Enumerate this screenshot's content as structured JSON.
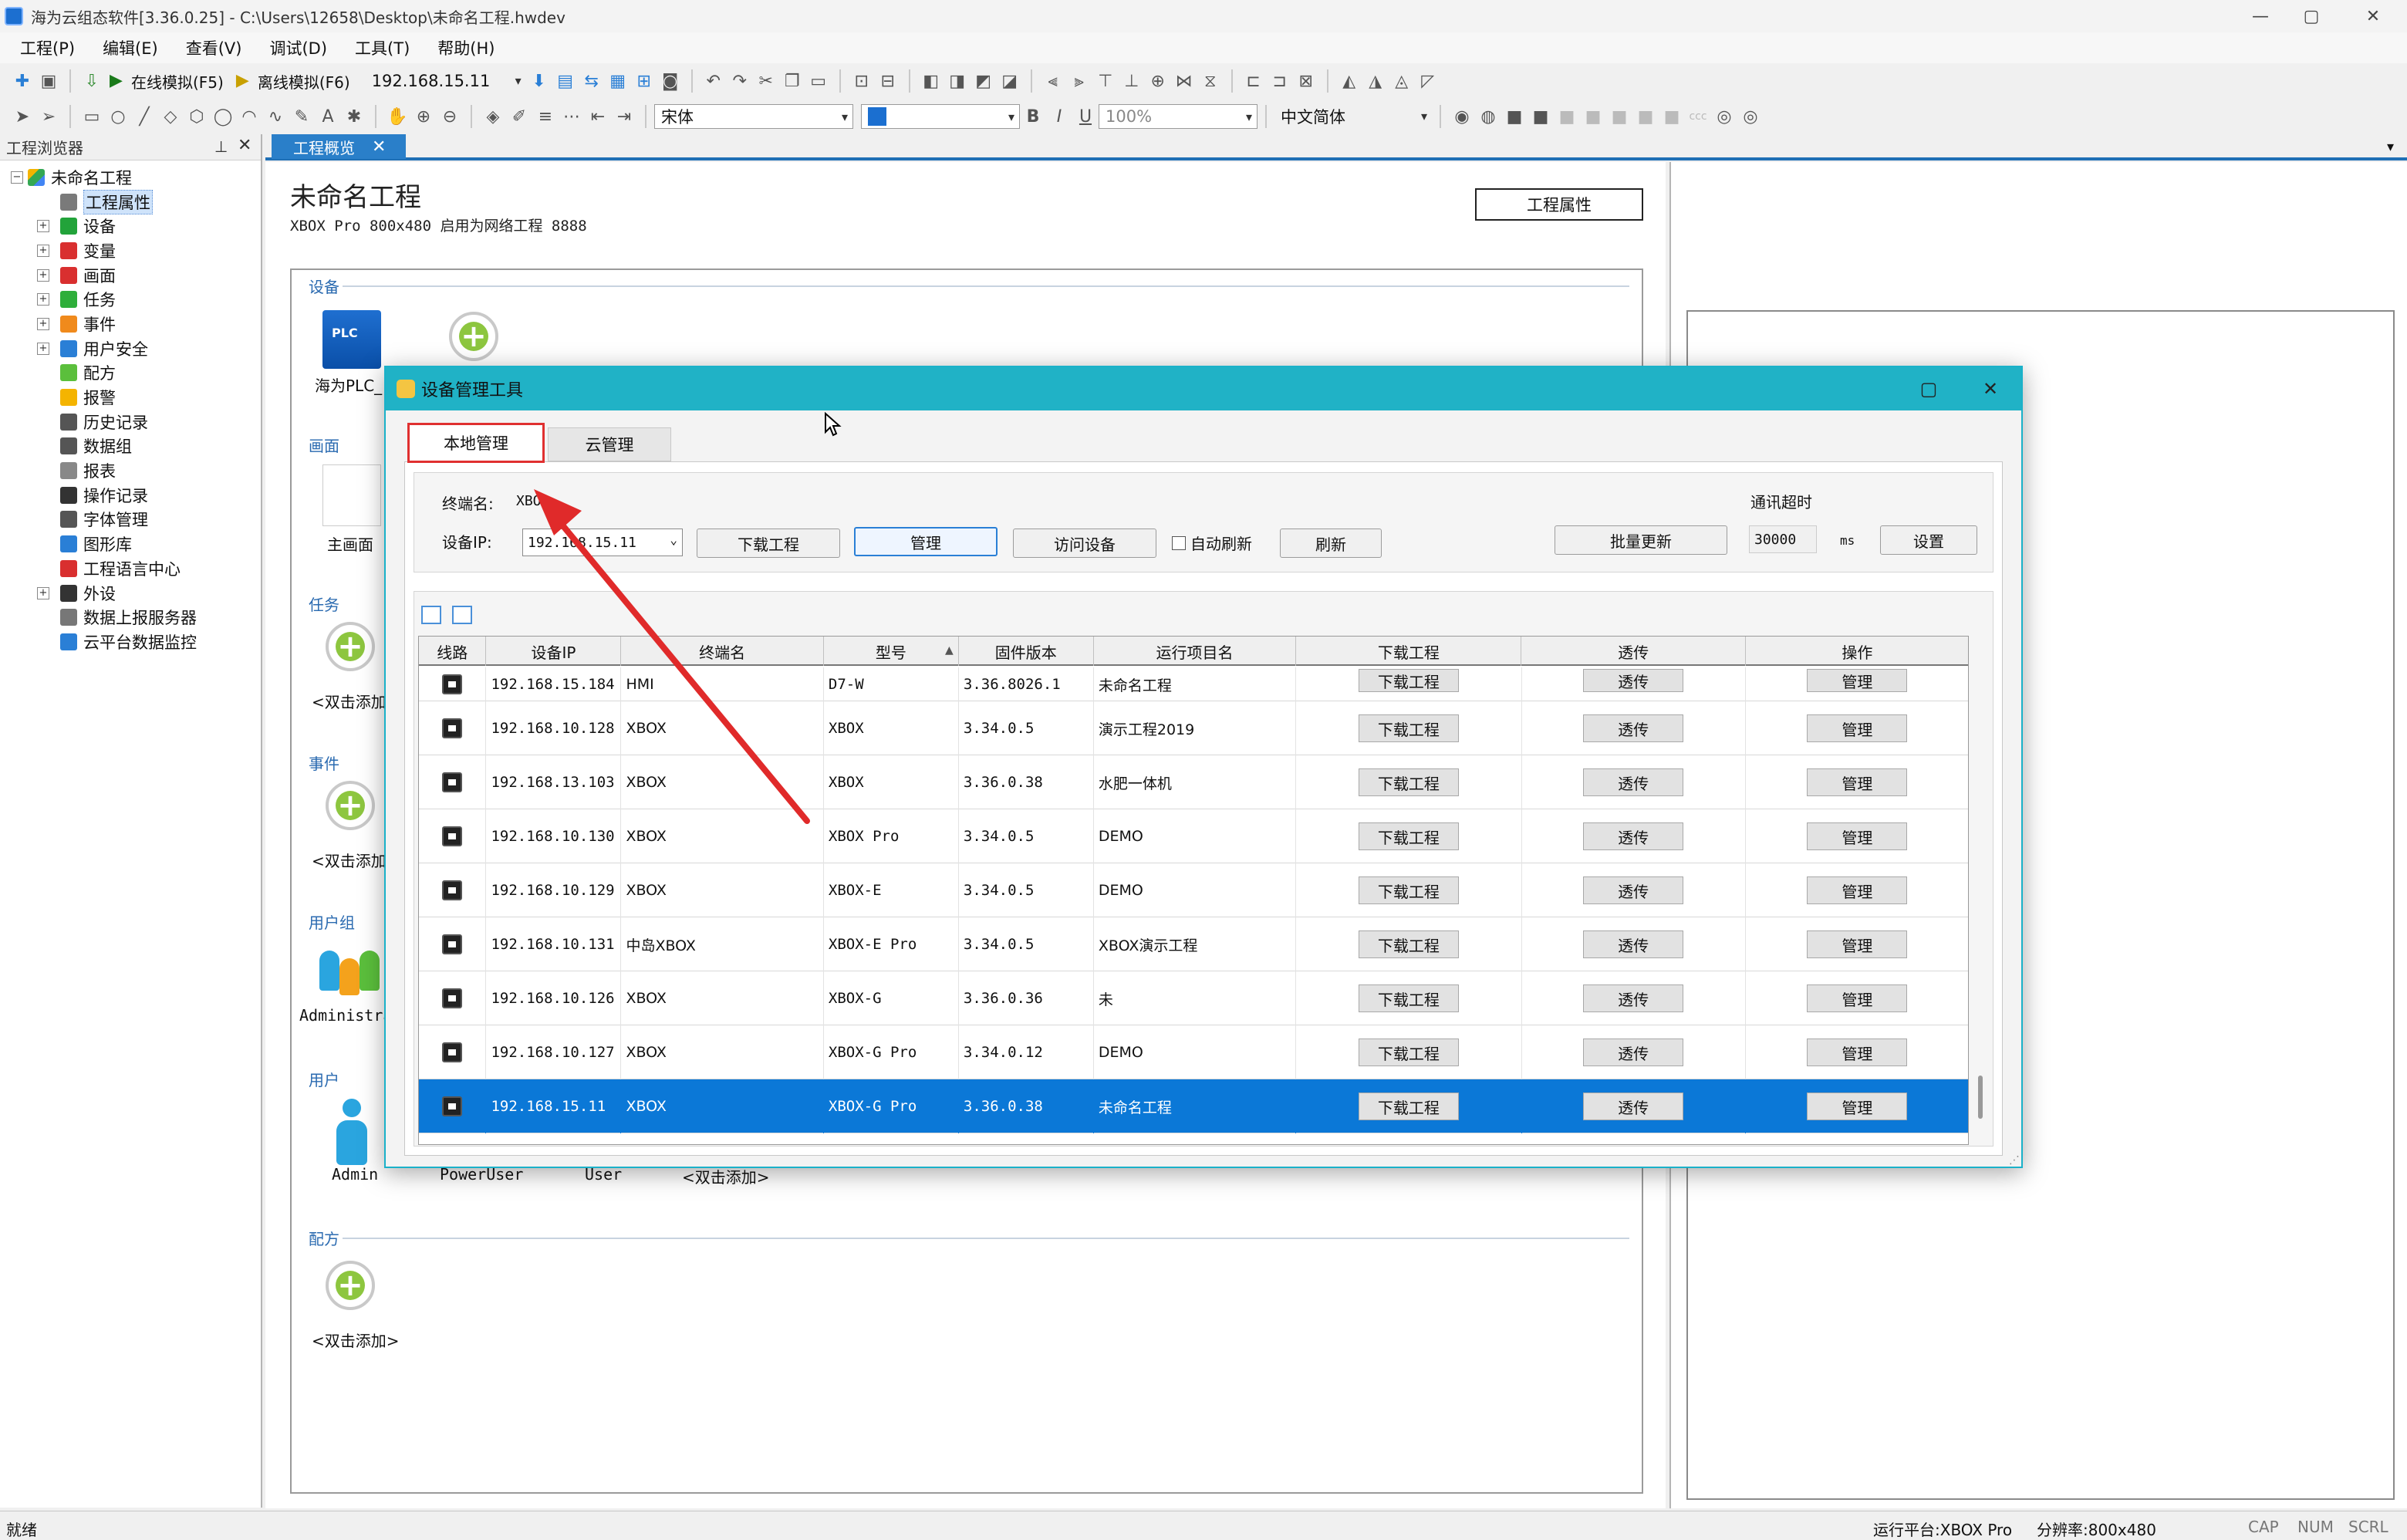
{
  "window": {
    "title": "海为云组态软件[3.36.0.25] - C:\\Users\\12658\\Desktop\\未命名工程.hwdev",
    "minimize": "—",
    "maximize": "▢",
    "close": "✕"
  },
  "menu": [
    "工程(P)",
    "编辑(E)",
    "查看(V)",
    "调试(D)",
    "工具(T)",
    "帮助(H)"
  ],
  "toolbar1": {
    "online_sim": "在线模拟(F5)",
    "offline_sim": "离线模拟(F6)",
    "ip_value": "192.168.15.11"
  },
  "toolbar2": {
    "font_value": "宋体",
    "zoom_value": "100%",
    "language_value": "中文简体"
  },
  "left_panel": {
    "title": "工程浏览器",
    "root": "未命名工程",
    "items": [
      {
        "label": "工程属性",
        "icon": "properties-icon",
        "expandable": false
      },
      {
        "label": "设备",
        "icon": "device-icon",
        "expandable": true
      },
      {
        "label": "变量",
        "icon": "variable-icon",
        "expandable": true
      },
      {
        "label": "画面",
        "icon": "screen-icon",
        "expandable": true
      },
      {
        "label": "任务",
        "icon": "task-icon",
        "expandable": true
      },
      {
        "label": "事件",
        "icon": "event-icon",
        "expandable": true
      },
      {
        "label": "用户安全",
        "icon": "user-security-icon",
        "expandable": true
      },
      {
        "label": "配方",
        "icon": "recipe-icon",
        "expandable": false
      },
      {
        "label": "报警",
        "icon": "alarm-bell-icon",
        "expandable": false
      },
      {
        "label": "历史记录",
        "icon": "history-clock-icon",
        "expandable": false
      },
      {
        "label": "数据组",
        "icon": "data-group-icon",
        "expandable": false
      },
      {
        "label": "报表",
        "icon": "report-icon",
        "expandable": false
      },
      {
        "label": "操作记录",
        "icon": "operation-log-icon",
        "expandable": false
      },
      {
        "label": "字体管理",
        "icon": "font-manager-icon",
        "expandable": false
      },
      {
        "label": "图形库",
        "icon": "graphics-library-icon",
        "expandable": false
      },
      {
        "label": "工程语言中心",
        "icon": "language-flag-icon",
        "expandable": false
      },
      {
        "label": "外设",
        "icon": "peripheral-tools-icon",
        "expandable": true
      },
      {
        "label": "数据上报服务器",
        "icon": "report-server-icon",
        "expandable": false
      },
      {
        "label": "云平台数据监控",
        "icon": "cloud-monitor-icon",
        "expandable": false
      }
    ]
  },
  "tab": {
    "label": "工程概览",
    "close": "✕"
  },
  "overview": {
    "title": "未命名工程",
    "subtitle": "XBOX Pro  800x480  启用为网络工程 8888",
    "properties_button": "工程属性",
    "sections": {
      "device": "设备",
      "screen": "画面",
      "task": "任务",
      "event": "事件",
      "user_group": "用户组",
      "user": "用户",
      "recipe": "配方"
    },
    "device_item": "海为PLC_",
    "plc_badge": "PLC",
    "screen_item": "主画面",
    "add_label": "<双击添加>",
    "group_item": "Administra",
    "users": [
      "Admin",
      "PowerUser",
      "User",
      "<双击添加>"
    ]
  },
  "dialog": {
    "title": "设备管理工具",
    "tabs": {
      "local": "本地管理",
      "cloud": "云管理"
    },
    "terminal_label": "终端名:",
    "terminal_value": "XBO",
    "ip_label": "设备IP:",
    "ip_value": "192.168.15.11",
    "buttons": {
      "download": "下载工程",
      "manage": "管理",
      "visit": "访问设备",
      "auto_refresh": "自动刷新",
      "refresh": "刷新",
      "batch_update": "批量更新",
      "settings": "设置"
    },
    "timeout_label": "通讯超时",
    "timeout_value": "30000",
    "timeout_unit": "ms",
    "grid": {
      "columns": [
        "线路",
        "设备IP",
        "终端名",
        "型号",
        "固件版本",
        "运行项目名",
        "下载工程",
        "透传",
        "操作"
      ],
      "row_btn_download": "下载工程",
      "row_btn_passthrough": "透传",
      "row_btn_manage": "管理",
      "rows": [
        {
          "ip": "192.168.15.184",
          "terminal": "HMI",
          "model": "D7-W",
          "firmware": "3.36.8026.1",
          "project": "未命名工程"
        },
        {
          "ip": "192.168.10.128",
          "terminal": "XBOX",
          "model": "XBOX",
          "firmware": "3.34.0.5",
          "project": "演示工程2019"
        },
        {
          "ip": "192.168.13.103",
          "terminal": "XBOX",
          "model": "XBOX",
          "firmware": "3.36.0.38",
          "project": "水肥一体机"
        },
        {
          "ip": "192.168.10.130",
          "terminal": "XBOX",
          "model": "XBOX Pro",
          "firmware": "3.34.0.5",
          "project": "DEMO"
        },
        {
          "ip": "192.168.10.129",
          "terminal": "XBOX",
          "model": "XBOX-E",
          "firmware": "3.34.0.5",
          "project": "DEMO"
        },
        {
          "ip": "192.168.10.131",
          "terminal": "中岛XBOX",
          "model": "XBOX-E Pro",
          "firmware": "3.34.0.5",
          "project": "XBOX演示工程"
        },
        {
          "ip": "192.168.10.126",
          "terminal": "XBOX",
          "model": "XBOX-G",
          "firmware": "3.36.0.36",
          "project": "未"
        },
        {
          "ip": "192.168.10.127",
          "terminal": "XBOX",
          "model": "XBOX-G Pro",
          "firmware": "3.34.0.12",
          "project": "DEMO"
        },
        {
          "ip": "192.168.15.11",
          "terminal": "XBOX",
          "model": "XBOX-G Pro",
          "firmware": "3.36.0.38",
          "project": "未命名工程",
          "selected": true
        }
      ]
    }
  },
  "status": {
    "left": "就绪",
    "platform": "运行平台:XBOX Pro",
    "resolution": "分辨率:800x480",
    "cap": "CAP",
    "num": "NUM",
    "scrl": "SCRL"
  },
  "colors": {
    "dialog_title": "#20b2c6",
    "selection": "#0b78d7",
    "annotation_red": "#e02a2a",
    "tab_blue": "#2a7fc9"
  }
}
